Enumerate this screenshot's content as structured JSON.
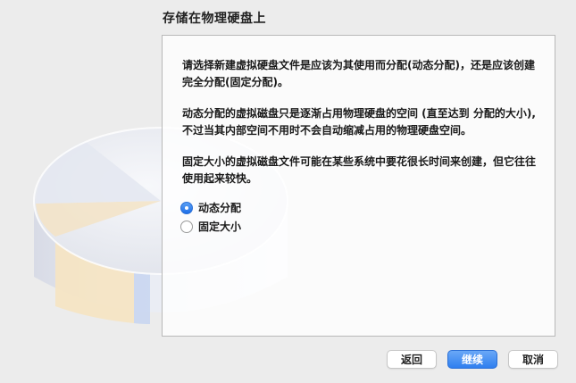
{
  "header": {
    "title": "存储在物理硬盘上"
  },
  "panel": {
    "para1": "请选择新建虚拟硬盘文件是应该为其使用而分配(动态分配)，还是应该创建完全分配(固定分配)。",
    "para2": "动态分配的虚拟磁盘只是逐渐占用物理硬盘的空间 (直至达到 分配的大小), 不过当其内部空间不用时不会自动缩减占用的物理硬盘空间。",
    "para3": "固定大小的虚拟磁盘文件可能在某些系统中要花很长时间来创建，但它往往使用起来较快。",
    "options": [
      {
        "label": "动态分配",
        "selected": true
      },
      {
        "label": "固定大小",
        "selected": false
      }
    ]
  },
  "buttons": {
    "back": "返回",
    "continue": "继续",
    "cancel": "取消"
  },
  "colors": {
    "accent": "#2f7fef",
    "background": "#ececec"
  }
}
